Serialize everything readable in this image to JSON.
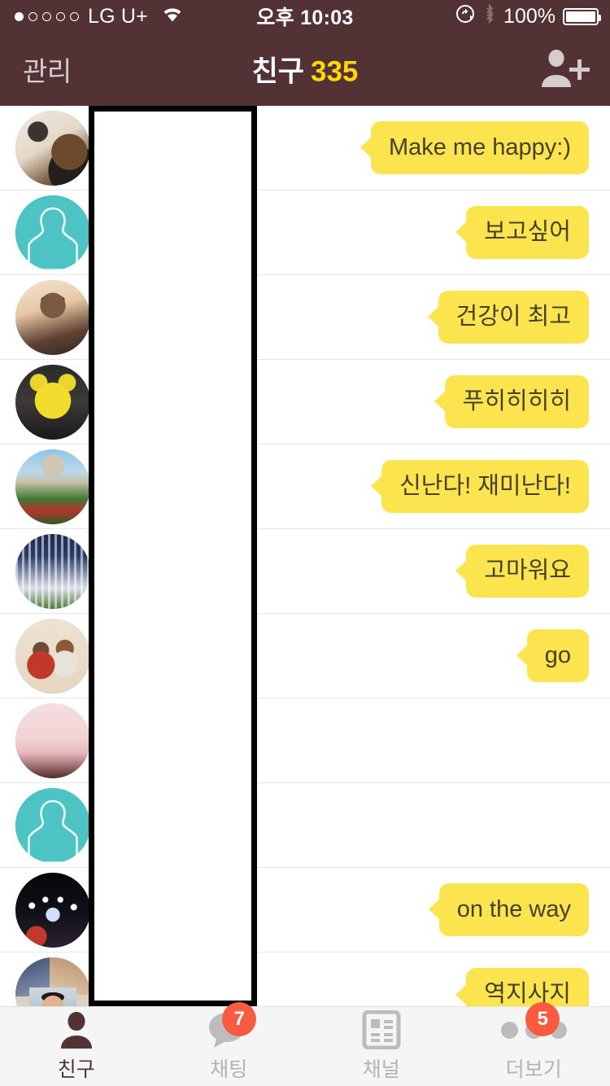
{
  "status_bar": {
    "signal_dots_total": 5,
    "signal_dots_filled": 1,
    "carrier": "LG U+",
    "wifi_icon": "wifi-icon",
    "time": "오후 10:03",
    "rotation_lock_icon": "rotation-lock-icon",
    "bluetooth_icon": "bluetooth-icon",
    "battery_percent": "100%",
    "battery_level": 100
  },
  "header": {
    "manage_label": "관리",
    "title": "친구",
    "friend_count": "335",
    "add_friend_icon": "add-friend-icon",
    "background_color": "#533235",
    "count_color": "#FFD800"
  },
  "colors": {
    "bubble": "#FCE44F",
    "bubble_text": "#46412C",
    "badge": "#F95B40",
    "default_avatar": "#4EC3C3",
    "separator": "#E8E8E8"
  },
  "friends": [
    {
      "avatar_type": "photo-woman-with-dog",
      "avatar_name": "avatar-photo",
      "name": "",
      "status_message": "Make me happy:)"
    },
    {
      "avatar_type": "default-silhouette",
      "avatar_name": "avatar-default",
      "name": "",
      "status_message": "보고싶어"
    },
    {
      "avatar_type": "photo-man-glasses",
      "avatar_name": "avatar-photo",
      "name": "",
      "status_message": "건강이 최고"
    },
    {
      "avatar_type": "photo-yellow-bear-toy",
      "avatar_name": "avatar-photo",
      "name": "",
      "status_message": "푸히히히히"
    },
    {
      "avatar_type": "photo-cathedral-travel",
      "avatar_name": "avatar-photo",
      "name": "",
      "status_message": "신난다! 재미난다!"
    },
    {
      "avatar_type": "photo-baseball-team",
      "avatar_name": "avatar-photo",
      "name": "",
      "status_message": "고마워요"
    },
    {
      "avatar_type": "photo-couple-illustration",
      "avatar_name": "avatar-photo",
      "name": "",
      "status_message": "go"
    },
    {
      "avatar_type": "photo-pink-room",
      "avatar_name": "avatar-photo",
      "name": "",
      "status_message": ""
    },
    {
      "avatar_type": "default-silhouette",
      "avatar_name": "avatar-default",
      "name": "",
      "status_message": ""
    },
    {
      "avatar_type": "photo-night-street-lights",
      "avatar_name": "avatar-photo",
      "name": "",
      "status_message": "on the way"
    },
    {
      "avatar_type": "photo-collage-person",
      "avatar_name": "avatar-photo",
      "name": "",
      "status_message": "역지사지"
    }
  ],
  "redaction": {
    "present": true,
    "description": "white-box-over-name-column"
  },
  "tab_bar": {
    "tabs": [
      {
        "label": "친구",
        "icon": "person-icon",
        "active": true,
        "badge": ""
      },
      {
        "label": "채팅",
        "icon": "chat-bubble-icon",
        "active": false,
        "badge": "7"
      },
      {
        "label": "채널",
        "icon": "channel-icon",
        "active": false,
        "badge": ""
      },
      {
        "label": "더보기",
        "icon": "more-dots-icon",
        "active": false,
        "badge": "5"
      }
    ]
  }
}
